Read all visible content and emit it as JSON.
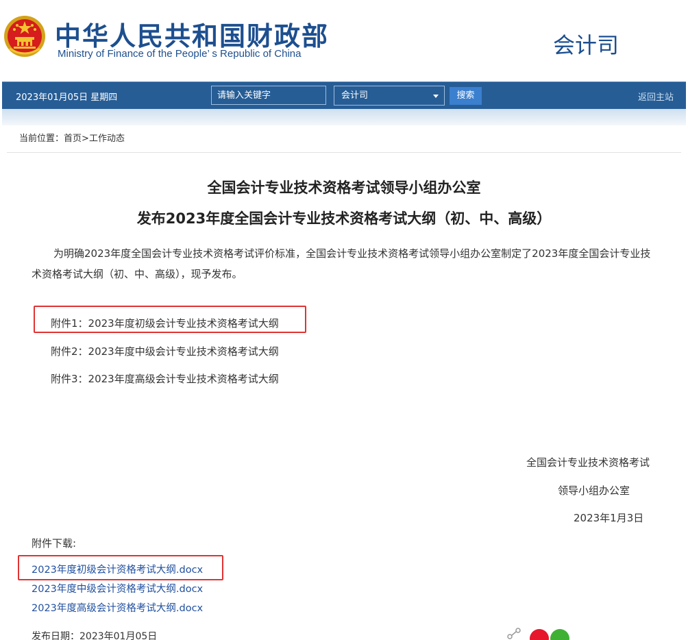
{
  "header": {
    "ministry_cn": "中华人民共和国财政部",
    "ministry_en": "Ministry of Finance of the People’ s Republic of China",
    "dept_name": "会计司"
  },
  "navbar": {
    "date": "2023年01月05日  星期四",
    "search_placeholder": "请输入关键字",
    "select_value": "会计司",
    "search_button": "搜索",
    "home_link": "返回主站"
  },
  "breadcrumb": {
    "label": "当前位置：",
    "home": "首页",
    "separator": ">",
    "current": "工作动态"
  },
  "article": {
    "title_line1": "全国会计专业技术资格考试领导小组办公室",
    "title_line2": "发布2023年度全国会计专业技术资格考试大纲（初、中、高级）",
    "paragraph": "为明确2023年度全国会计专业技术资格考试评价标准，全国会计专业技术资格考试领导小组办公室制定了2023年度全国会计专业技术资格考试大纲（初、中、高级），现予发布。",
    "attachments": [
      "附件1：2023年度初级会计专业技术资格考试大纲",
      "附件2：2023年度中级会计专业技术资格考试大纲",
      "附件3：2023年度高级会计专业技术资格考试大纲"
    ],
    "signature_line1": "全国会计专业技术资格考试",
    "signature_line2": "领导小组办公室",
    "signature_date": "2023年1月3日"
  },
  "downloads": {
    "title": "附件下载:",
    "files": [
      "2023年度初级会计资格考试大纲.docx",
      "2023年度中级会计资格考试大纲.docx",
      "2023年度高级会计资格考试大纲.docx"
    ]
  },
  "footer": {
    "publish_date": "发布日期：2023年01月05日"
  },
  "colors": {
    "brand_blue": "#1d4f8f",
    "nav_bg": "#275d95",
    "highlight_red": "#e03232",
    "link_blue": "#1f4f9e"
  },
  "icons": [
    "national-emblem-icon",
    "dropdown-arrow-icon",
    "share-icon",
    "weibo-icon",
    "wechat-icon"
  ]
}
